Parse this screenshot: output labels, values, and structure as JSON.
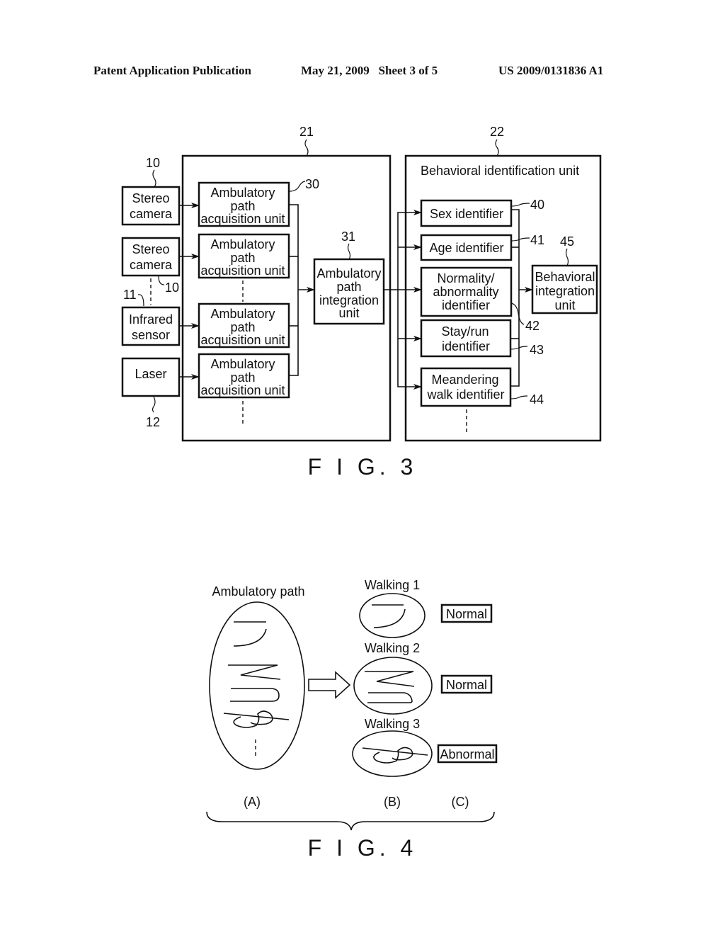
{
  "header": {
    "publication": "Patent Application Publication",
    "date_sheet": "May 21, 2009   Sheet 3 of 5",
    "number": "US 2009/0131836 A1"
  },
  "fig3": {
    "caption": "F I G. 3",
    "unit21": {
      "ref": "21"
    },
    "unit22": {
      "ref": "22",
      "title": "Behavioral identification unit"
    },
    "sensors": [
      {
        "ref": "10",
        "lines": [
          "Stereo",
          "camera"
        ]
      },
      {
        "ref": "10",
        "lines": [
          "Stereo",
          "camera"
        ]
      },
      {
        "ref": "11",
        "lines": [
          "Infrared",
          "sensor"
        ]
      },
      {
        "ref": "12",
        "lines": [
          "Laser"
        ]
      }
    ],
    "acquisition": {
      "ref": "30",
      "lines": [
        "Ambulatory",
        "path",
        "acquisition unit"
      ]
    },
    "integration": {
      "ref": "31",
      "lines": [
        "Ambulatory",
        "path",
        "integration",
        "unit"
      ]
    },
    "identifiers": [
      {
        "ref": "40",
        "lines": [
          "Sex identifier"
        ]
      },
      {
        "ref": "41",
        "lines": [
          "Age identifier"
        ]
      },
      {
        "ref": "42",
        "lines": [
          "Normality/",
          "abnormality",
          "identifier"
        ]
      },
      {
        "ref": "43",
        "lines": [
          "Stay/run",
          "identifier"
        ]
      },
      {
        "ref": "44",
        "lines": [
          "Meandering",
          "walk identifier"
        ]
      }
    ],
    "behavioral_integration": {
      "ref": "45",
      "lines": [
        "Behavioral",
        "integration",
        "unit"
      ]
    }
  },
  "fig4": {
    "caption": "F I G. 4",
    "path_title": "Ambulatory path",
    "walkings": [
      {
        "label": "Walking 1",
        "result": "Normal"
      },
      {
        "label": "Walking 2",
        "result": "Normal"
      },
      {
        "label": "Walking 3",
        "result": "Abnormal"
      }
    ],
    "panels": [
      "(A)",
      "(B)",
      "(C)"
    ]
  }
}
